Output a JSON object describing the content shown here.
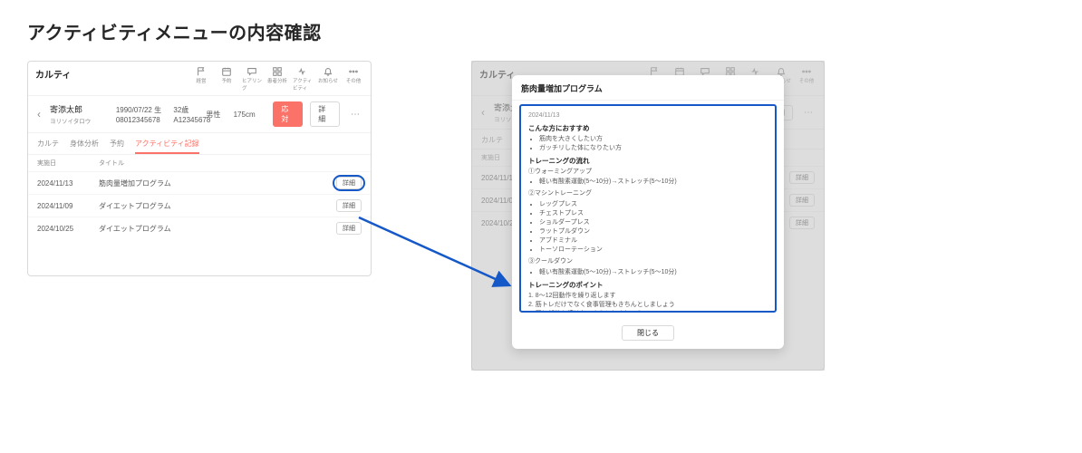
{
  "page_title": "アクティビティメニューの内容確認",
  "app_name": "カルティ",
  "toolbar": [
    {
      "icon": "flag",
      "label": "経営"
    },
    {
      "icon": "calendar",
      "label": "予約"
    },
    {
      "icon": "chat",
      "label": "ヒアリング"
    },
    {
      "icon": "grid",
      "label": "患者分析"
    },
    {
      "icon": "activity",
      "label": "アクティビティ"
    },
    {
      "icon": "bell",
      "label": "お知らせ"
    },
    {
      "icon": "dots",
      "label": "その他"
    }
  ],
  "patient": {
    "name": "寄添太郎",
    "kana": "ヨリソイタロウ",
    "birth": "1990/07/22 生",
    "age": "32歳",
    "sex": "男性",
    "height": "175cm",
    "phone": "08012345678",
    "id": "A12345678"
  },
  "actions": {
    "primary": "応対",
    "secondary": "詳細"
  },
  "tabs": [
    "カルテ",
    "身体分析",
    "予約",
    "アクティビティ記録"
  ],
  "active_tab": "アクティビティ記録",
  "list_headers": {
    "date": "実施日",
    "title": "タイトル"
  },
  "records": [
    {
      "date": "2024/11/13",
      "title": "筋肉量増加プログラム"
    },
    {
      "date": "2024/11/09",
      "title": "ダイエットプログラム"
    },
    {
      "date": "2024/10/25",
      "title": "ダイエットプログラム"
    }
  ],
  "detail_label": "詳細",
  "modal": {
    "title": "筋肉量増加プログラム",
    "date": "2024/11/13",
    "sec1_h": "こんな方におすすめ",
    "sec1": [
      "筋肉を大きくしたい方",
      "ガッチリした体になりたい方"
    ],
    "sec2_h": "トレーニングの流れ",
    "sec2a_h": "①ウォーミングアップ",
    "sec2a": [
      "軽い有酸素運動(5〜10分)→ストレッチ(5〜10分)"
    ],
    "sec2b_h": "②マシントレーニング",
    "sec2b": [
      "レッグプレス",
      "チェストプレス",
      "ショルダープレス",
      "ラットプルダウン",
      "アブドミナル",
      "トーソローテーション"
    ],
    "sec2c_h": "③クールダウン",
    "sec2c": [
      "軽い有酸素運動(5〜10分)→ストレッチ(5〜10分)"
    ],
    "sec3_h": "トレーニングのポイント",
    "sec3": [
      "8〜12回動作を繰り返します",
      "筋トレだけでなく食事管理もきちんとしましょう",
      "同じ部位を続けないようにしましょう"
    ],
    "close": "閉じる"
  }
}
